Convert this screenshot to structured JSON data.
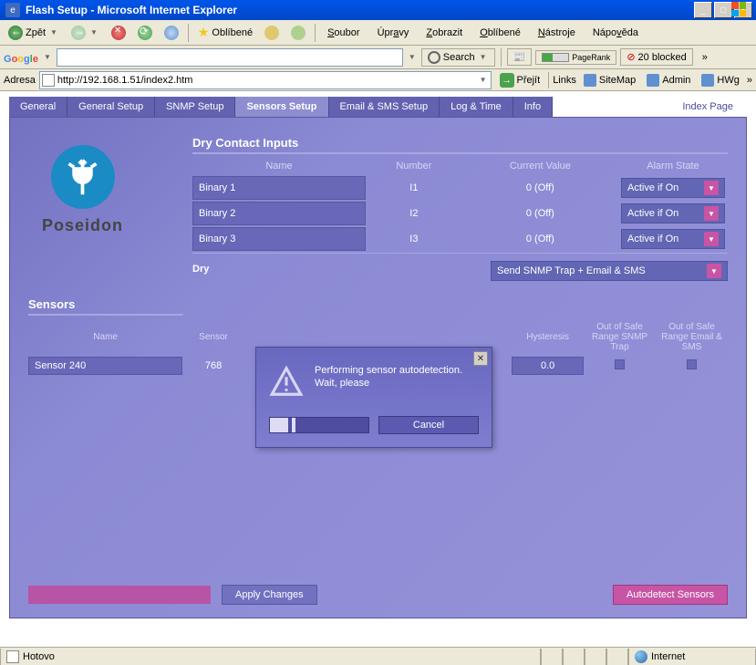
{
  "window": {
    "title": "Flash Setup - Microsoft Internet Explorer",
    "min": "_",
    "max": "□",
    "close": "✕"
  },
  "toolbar1": {
    "back": "Zpět",
    "favorites": "Oblíbené"
  },
  "menubar": {
    "file": "Soubor",
    "edit": "Úpravy",
    "view": "Zobrazit",
    "fav": "Oblíbené",
    "tools": "Nástroje",
    "help": "Nápověda"
  },
  "google": {
    "search_btn": "Search",
    "pagerank": "PageRank",
    "blocked": "20 blocked"
  },
  "addr": {
    "label": "Adresa",
    "url": "http://192.168.1.51/index2.htm",
    "go": "Přejít",
    "links": "Links",
    "l1": "SiteMap",
    "l2": "Admin",
    "l3": "HWg"
  },
  "tabs": {
    "general": "General",
    "general_setup": "General Setup",
    "snmp": "SNMP Setup",
    "sensors": "Sensors Setup",
    "email": "Email & SMS Setup",
    "log": "Log & Time",
    "info": "Info",
    "index": "Index Page"
  },
  "logo": "Poseidon",
  "dry": {
    "title": "Dry Contact Inputs",
    "h_name": "Name",
    "h_num": "Number",
    "h_cv": "Current Value",
    "h_as": "Alarm State",
    "rows": [
      {
        "name": "Binary 1",
        "num": "I1",
        "cv": "0 (Off)",
        "as": "Active if On"
      },
      {
        "name": "Binary 2",
        "num": "I2",
        "cv": "0 (Off)",
        "as": "Active if On"
      },
      {
        "name": "Binary 3",
        "num": "I3",
        "cv": "0 (Off)",
        "as": "Active if On"
      }
    ],
    "sub_label": "Dry",
    "action": "Send SNMP Trap + Email & SMS"
  },
  "sensors": {
    "title": "Sensors",
    "h_name": "Name",
    "h_sensor": "Sensor",
    "h_hyst": "Hysteresis",
    "h_snmp": "Out of Safe Range SNMP Trap",
    "h_email": "Out of Safe Range Email & SMS",
    "rows": [
      {
        "name": "Sensor 240",
        "sensor": "768",
        "hyst": "0.0"
      }
    ]
  },
  "buttons": {
    "apply": "Apply Changes",
    "autodetect": "Autodetect Sensors"
  },
  "modal": {
    "text": "Performing sensor autodetection. Wait, please",
    "cancel": "Cancel"
  },
  "status": {
    "ready": "Hotovo",
    "zone": "Internet"
  }
}
